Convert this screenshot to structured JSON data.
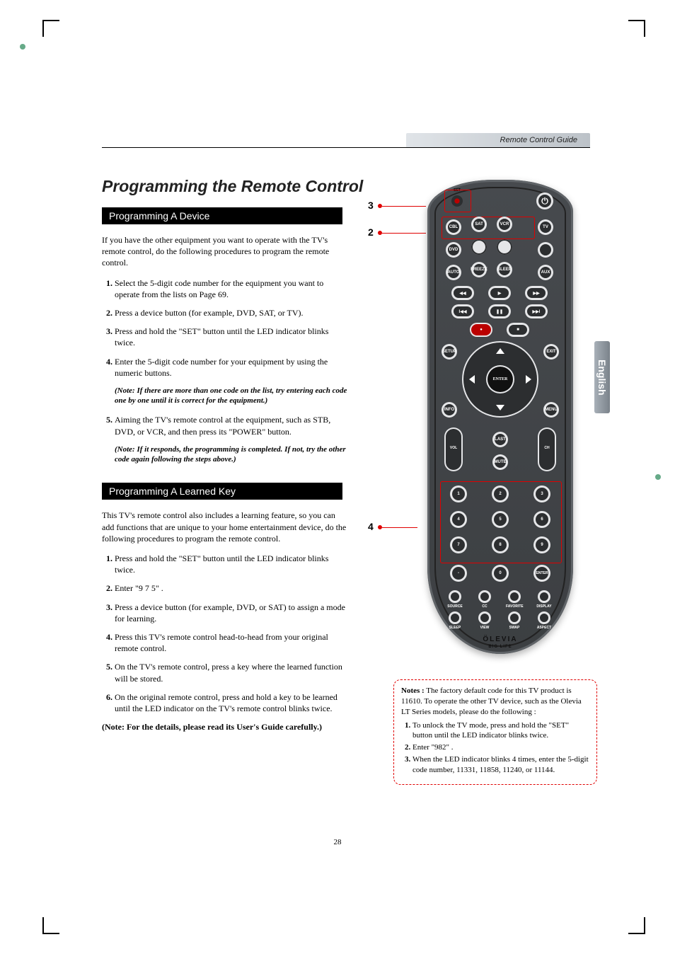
{
  "header": {
    "label": "Remote Control Guide"
  },
  "language_tab": "English",
  "title": "Programming the Remote Control",
  "section1": {
    "heading": "Programming A Device",
    "intro": "If you have the other equipment you want to operate with the TV's remote control, do the following procedures to program the remote control.",
    "steps": [
      "Select the 5-digit code number for the equipment you want to operate from the lists on Page 69.",
      "Press a device button (for example, DVD, SAT, or TV).",
      "Press and hold the \"SET\" button until the LED indicator blinks twice.",
      "Enter the 5-digit code number for your equipment by using the numeric buttons.",
      "Aiming the TV's remote control at the equipment, such as STB, DVD, or VCR, and then press its \"POWER\" button."
    ],
    "note_after_4": "(Note: If there are more than one code on the list, try entering each code one by one until it is correct for the equipment.)",
    "note_after_5": "(Note: If it responds, the programming is completed. If not, try the other code again following the steps above.)"
  },
  "section2": {
    "heading": "Programming A Learned Key",
    "intro": "This TV's remote control also includes a learning feature, so you can add functions that are unique to your home entertainment device, do the following procedures to program the remote control.",
    "steps": [
      "Press and hold the \"SET\" button until the LED indicator blinks twice.",
      "Enter \"9 7 5\" .",
      "Press a device button (for example, DVD, or SAT) to assign a mode for learning.",
      "Press this TV's remote control head-to-head from your original remote control.",
      "On the TV's remote control, press a key where the learned function will be stored.",
      "On the original remote control, press and hold a key to be learned until the LED indicator on the TV's remote control blinks twice."
    ],
    "final_note": "(Note:  For the details, please read its User's Guide carefully.)"
  },
  "notes_box": {
    "heading": "Notes :",
    "intro": " The factory default code for this TV product is 11610. To operate the other TV device, such as the Olevia LT Series models, please do the following :",
    "steps": [
      "To unlock the TV mode, press and hold the \"SET\" button until the LED indicator blinks twice.",
      "Enter \"982\" .",
      "When the LED indicator blinks 4 times, enter the 5-digit code number, 11331, 11858, 11240, or 11144."
    ]
  },
  "callouts": {
    "c2": "2",
    "c3": "3",
    "c4": "4"
  },
  "remote": {
    "set_label": "SET",
    "buttons_row1": [
      "CBL",
      "SAT",
      "VCR"
    ],
    "buttons_row1r": "TV",
    "buttons_row2": [
      "DVD",
      "○",
      "○"
    ],
    "buttons_row2r": "○",
    "buttons_row3": [
      "AUTO",
      "FREEZE",
      "SLEEP"
    ],
    "buttons_row3r": "AUX",
    "enter": "ENTER",
    "side_btns": [
      "SETUP",
      "EXIT",
      "INFO",
      "MENU"
    ],
    "last": "LAST",
    "mute": "MUTE",
    "vol": "VOL",
    "ch": "CH",
    "numpad": [
      "1",
      "2",
      "3",
      "4",
      "5",
      "6",
      "7",
      "8",
      "9",
      "-",
      "0",
      "ENTER"
    ],
    "func_row1": [
      "SOURCE",
      "CC",
      "FAVORITE",
      "DISPLAY"
    ],
    "func_row2": [
      "SLEEP",
      "VIEW",
      "SWAP",
      "ASPECT"
    ],
    "brand": "ÖLEVIA",
    "brand_sub": "BIG LIFE",
    "power": "⏻"
  },
  "page_number": "28"
}
